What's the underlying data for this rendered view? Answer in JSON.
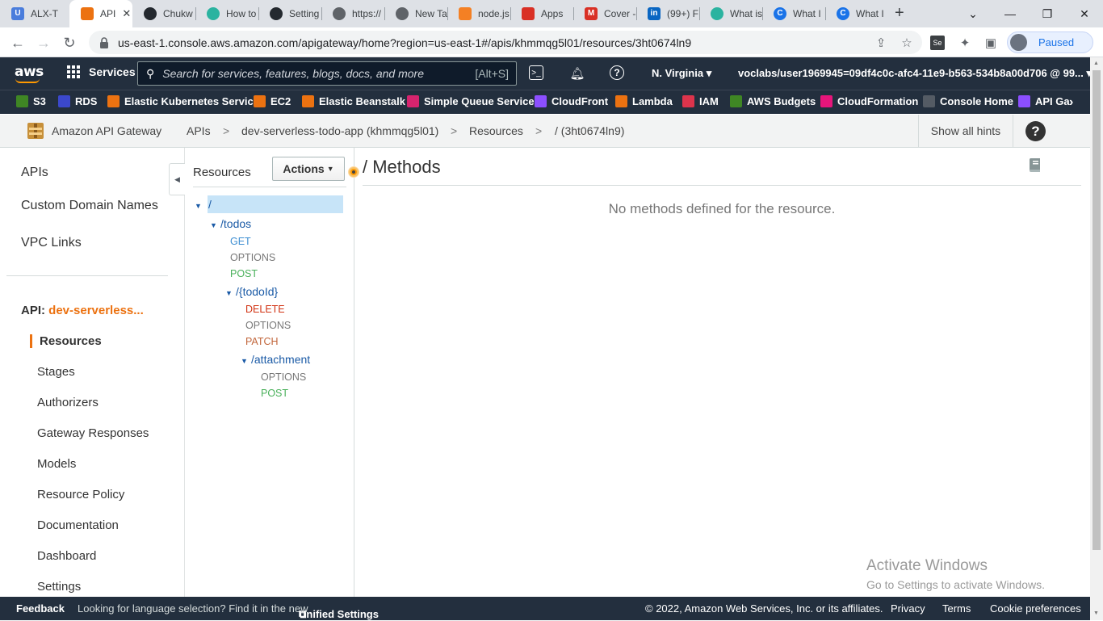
{
  "browser": {
    "tabs": [
      {
        "title": "ALX-T",
        "favicon": "u-icon",
        "color": "#4a7ddc"
      },
      {
        "title": "API",
        "favicon": "aws-box-icon",
        "color": "#ec7211",
        "active": true
      },
      {
        "title": "Chukw",
        "favicon": "github-icon",
        "color": "#24292f"
      },
      {
        "title": "How to",
        "favicon": "eye-icon",
        "color": "#2bb3a0"
      },
      {
        "title": "Setting",
        "favicon": "github-icon",
        "color": "#24292f"
      },
      {
        "title": "https://",
        "favicon": "globe-icon",
        "color": "#5f6368"
      },
      {
        "title": "New Ta",
        "favicon": "chrome-icon",
        "color": "#5f6368"
      },
      {
        "title": "node.js",
        "favicon": "stackoverflow-icon",
        "color": "#f48024"
      },
      {
        "title": "Apps",
        "favicon": "feather-icon",
        "color": "#d93025"
      },
      {
        "title": "Cover -",
        "favicon": "gmail-icon",
        "color": "#d93025"
      },
      {
        "title": "(99+) F",
        "favicon": "linkedin-icon",
        "color": "#0a66c2"
      },
      {
        "title": "What is",
        "favicon": "eye-icon",
        "color": "#2bb3a0"
      },
      {
        "title": "What I",
        "favicon": "c-icon",
        "color": "#1a73e8"
      },
      {
        "title": "What I",
        "favicon": "c-icon",
        "color": "#1a73e8"
      }
    ],
    "new_tab": "+",
    "url": "us-east-1.console.aws.amazon.com/apigateway/home?region=us-east-1#/apis/khmmqg5l01/resources/3ht0674ln9",
    "profile_status": "Paused"
  },
  "aws_nav": {
    "logo": "aws",
    "services_label": "Services",
    "search_placeholder": "Search for services, features, blogs, docs, and more",
    "search_shortcut": "[Alt+S]",
    "region": "N. Virginia",
    "account": "voclabs/user1969945=09df4c0c-afc4-11e9-b563-534b8a00d706 @ 99..."
  },
  "favorites": [
    {
      "label": "S3",
      "color": "#3f8624"
    },
    {
      "label": "RDS",
      "color": "#3b48cc"
    },
    {
      "label": "Elastic Kubernetes Service",
      "color": "#ec7211"
    },
    {
      "label": "EC2",
      "color": "#ec7211"
    },
    {
      "label": "Elastic Beanstalk",
      "color": "#ec7211"
    },
    {
      "label": "Simple Queue Service",
      "color": "#d6246e"
    },
    {
      "label": "CloudFront",
      "color": "#8c4fff"
    },
    {
      "label": "Lambda",
      "color": "#ec7211"
    },
    {
      "label": "IAM",
      "color": "#dd344c"
    },
    {
      "label": "AWS Budgets",
      "color": "#3f8624"
    },
    {
      "label": "CloudFormation",
      "color": "#e7157b"
    },
    {
      "label": "Console Home",
      "color": "#545b64"
    },
    {
      "label": "API Ga",
      "color": "#8c4fff"
    }
  ],
  "service_header": {
    "service_name": "Amazon API Gateway",
    "breadcrumbs": [
      "APIs",
      "dev-serverless-todo-app (khmmqg5l01)",
      "Resources",
      "/ (3ht0674ln9)"
    ],
    "separator": ">",
    "show_hints": "Show all hints",
    "help": "?"
  },
  "left_nav": {
    "top_items": [
      "APIs",
      "Custom Domain Names",
      "VPC Links"
    ],
    "api_prefix": "API:",
    "api_name": "dev-serverless...",
    "sub_items": [
      "Resources",
      "Stages",
      "Authorizers",
      "Gateway Responses",
      "Models",
      "Resource Policy",
      "Documentation",
      "Dashboard",
      "Settings"
    ]
  },
  "resources_panel": {
    "title": "Resources",
    "actions_label": "Actions",
    "tree": {
      "root": "/",
      "todos": "/todos",
      "todos_methods": [
        "GET",
        "OPTIONS",
        "POST"
      ],
      "todoid": "/{todoId}",
      "todoid_methods": [
        "DELETE",
        "OPTIONS",
        "PATCH"
      ],
      "attachment": "/attachment",
      "attachment_methods": [
        "OPTIONS",
        "POST"
      ]
    }
  },
  "main": {
    "title": "/ Methods",
    "empty_message": "No methods defined for the resource."
  },
  "watermark": {
    "line1": "Activate Windows",
    "line2": "Go to Settings to activate Windows."
  },
  "footer": {
    "feedback": "Feedback",
    "language_msg": "Looking for language selection? Find it in the new",
    "unified_settings": "Unified Settings",
    "copyright": "© 2022, Amazon Web Services, Inc. or its affiliates.",
    "privacy": "Privacy",
    "terms": "Terms",
    "cookies": "Cookie preferences"
  }
}
